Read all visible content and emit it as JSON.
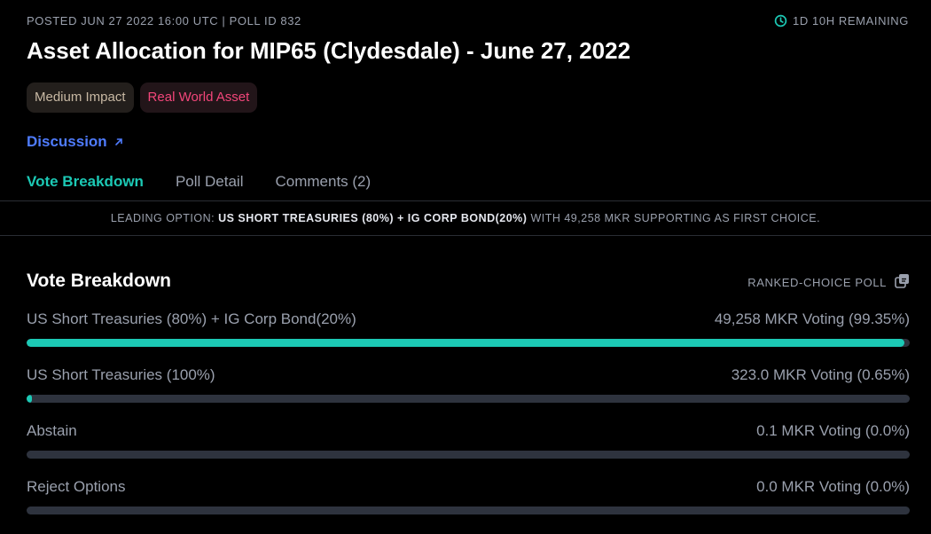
{
  "header": {
    "meta": "POSTED JUN 27 2022 16:00 UTC | POLL ID 832",
    "remaining": "1D 10H REMAINING",
    "title": "Asset Allocation for MIP65 (Clydesdale) - June 27, 2022"
  },
  "tags": [
    {
      "label": "Medium Impact"
    },
    {
      "label": "Real World Asset"
    }
  ],
  "discussion": {
    "label": "Discussion"
  },
  "tabs": [
    {
      "label": "Vote Breakdown",
      "active": true
    },
    {
      "label": "Poll Detail",
      "active": false
    },
    {
      "label": "Comments (2)",
      "active": false
    }
  ],
  "leading": {
    "prefix": "LEADING OPTION:",
    "option": "US SHORT TREASURIES (80%) + IG CORP BOND(20%)",
    "suffix": "WITH 49,258 MKR SUPPORTING AS FIRST CHOICE."
  },
  "breakdown": {
    "title": "Vote Breakdown",
    "poll_type": "RANKED-CHOICE POLL",
    "options": [
      {
        "label": "US Short Treasuries (80%) + IG Corp Bond(20%)",
        "votes": "49,258 MKR Voting (99.35%)",
        "fraction": 0.9935
      },
      {
        "label": "US Short Treasuries (100%)",
        "votes": "323.0 MKR Voting (0.65%)",
        "fraction": 0.0065
      },
      {
        "label": "Abstain",
        "votes": "0.1 MKR Voting (0.0%)",
        "fraction": 0
      },
      {
        "label": "Reject Options",
        "votes": "0.0 MKR Voting (0.0%)",
        "fraction": 0
      }
    ]
  },
  "colors": {
    "accent": "#1cc9b5",
    "link": "#4f7cff",
    "tag_rwa": "#f2467a",
    "track": "#2e333e"
  },
  "icons": {
    "remaining": "clock-icon",
    "discussion": "external-link-arrow-icon",
    "poll_type": "copy-icon"
  }
}
